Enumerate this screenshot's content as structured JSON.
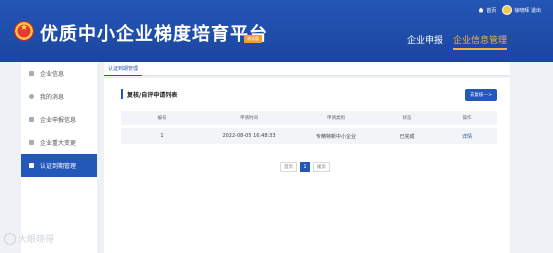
{
  "header": {
    "util_home": "首页",
    "util_user": "徐晓晖 退出",
    "title": "优质中小企业梯度培育平台",
    "badge": "测试版",
    "nav": [
      "企业申报",
      "企业信息管理"
    ]
  },
  "sidebar": {
    "items": [
      {
        "label": "企业信息"
      },
      {
        "label": "我的消息"
      },
      {
        "label": "企业申报信息"
      },
      {
        "label": "企业重大变更"
      },
      {
        "label": "认证到期管理"
      }
    ]
  },
  "tab": {
    "label": "认证到期管理"
  },
  "section": {
    "title": "复核/自评申请列表",
    "button": "去复核--->"
  },
  "table": {
    "headers": [
      "编号",
      "申请时间",
      "申请类别",
      "状态",
      "操作"
    ],
    "rows": [
      {
        "id": "1",
        "time": "2022-08-05 16:48:33",
        "category": "专精特新中小企业",
        "status": "已完成",
        "action": "详情"
      }
    ]
  },
  "pager": {
    "prev": "首页",
    "current": "1",
    "next": "尾页"
  },
  "watermark": "大眼晓得",
  "colors": {
    "primary": "#2357b8",
    "accent": "#f5b04a"
  }
}
